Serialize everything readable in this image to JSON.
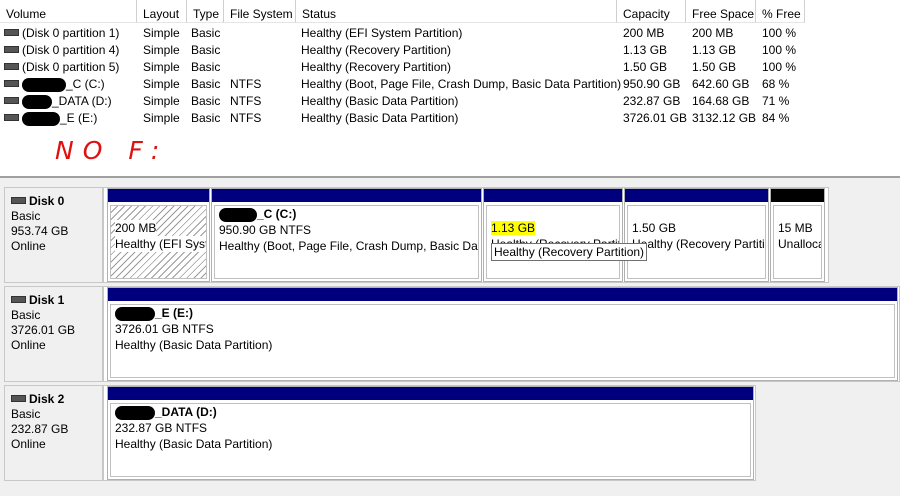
{
  "columns": [
    "Volume",
    "Layout",
    "Type",
    "File System",
    "Status",
    "Capacity",
    "Free Space",
    "% Free"
  ],
  "volumes": [
    {
      "name": "(Disk 0 partition 1)",
      "layout": "Simple",
      "type": "Basic",
      "fs": "",
      "status": "Healthy (EFI System Partition)",
      "capacity": "200 MB",
      "free": "200 MB",
      "pct": "100 %"
    },
    {
      "name": "(Disk 0 partition 4)",
      "layout": "Simple",
      "type": "Basic",
      "fs": "",
      "status": "Healthy (Recovery Partition)",
      "capacity": "1.13 GB",
      "free": "1.13 GB",
      "pct": "100 %"
    },
    {
      "name": "(Disk 0 partition 5)",
      "layout": "Simple",
      "type": "Basic",
      "fs": "",
      "status": "Healthy (Recovery Partition)",
      "capacity": "1.50 GB",
      "free": "1.50 GB",
      "pct": "100 %"
    },
    {
      "name": "_C (C:)",
      "layout": "Simple",
      "type": "Basic",
      "fs": "NTFS",
      "status": "Healthy (Boot, Page File, Crash Dump, Basic Data Partition)",
      "capacity": "950.90 GB",
      "free": "642.60 GB",
      "pct": "68 %"
    },
    {
      "name": "_DATA (D:)",
      "layout": "Simple",
      "type": "Basic",
      "fs": "NTFS",
      "status": "Healthy (Basic Data Partition)",
      "capacity": "232.87 GB",
      "free": "164.68 GB",
      "pct": "71 %"
    },
    {
      "name": "_E (E:)",
      "layout": "Simple",
      "type": "Basic",
      "fs": "NTFS",
      "status": "Healthy (Basic Data Partition)",
      "capacity": "3726.01 GB",
      "free": "3132.12 GB",
      "pct": "84 %"
    }
  ],
  "annotation": "NO F:",
  "disks": [
    {
      "title": "Disk 0",
      "type": "Basic",
      "size": "953.74 GB",
      "state": "Online",
      "partitions": [
        {
          "name": "",
          "size": "200 MB",
          "status": "Healthy (EFI System Partition)"
        },
        {
          "name": "_C  (C:)",
          "size": "950.90 GB NTFS",
          "status": "Healthy (Boot, Page File, Crash Dump, Basic Data Partition)"
        },
        {
          "name": "",
          "size": "1.13 GB",
          "status": "Healthy (Recovery Partition)"
        },
        {
          "name": "",
          "size": "1.50 GB",
          "status": "Healthy (Recovery Partition)"
        },
        {
          "name": "",
          "size": "15 MB",
          "status": "Unallocated"
        }
      ]
    },
    {
      "title": "Disk 1",
      "type": "Basic",
      "size": "3726.01 GB",
      "state": "Online",
      "partitions": [
        {
          "name": "_E  (E:)",
          "size": "3726.01 GB NTFS",
          "status": "Healthy (Basic Data Partition)"
        }
      ]
    },
    {
      "title": "Disk 2",
      "type": "Basic",
      "size": "232.87 GB",
      "state": "Online",
      "partitions": [
        {
          "name": "_DATA  (D:)",
          "size": "232.87 GB NTFS",
          "status": "Healthy (Basic Data Partition)"
        }
      ]
    }
  ],
  "tooltip": "Healthy (Recovery Partition)",
  "colors": {
    "primary_partition_bar": "#00007f",
    "unallocated_bar": "#000000",
    "highlight": "#ffff00",
    "annotation": "#e01010"
  }
}
